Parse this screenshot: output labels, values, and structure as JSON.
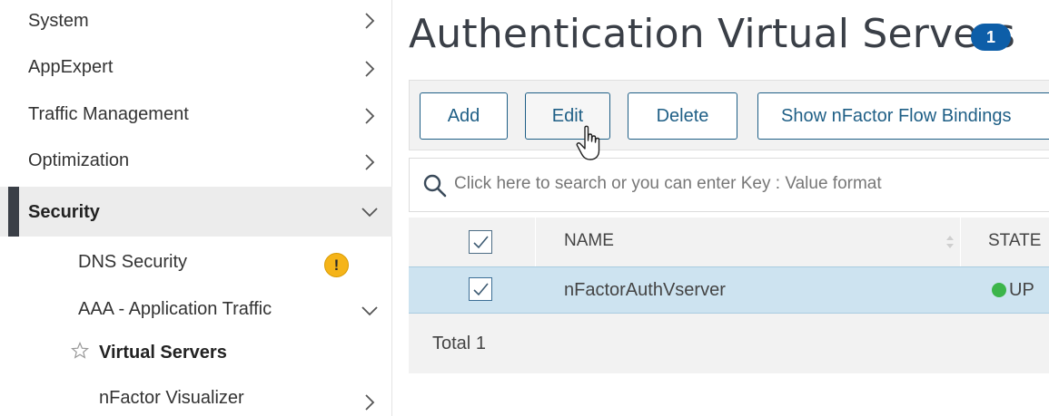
{
  "sidebar": {
    "items": [
      {
        "label": "System"
      },
      {
        "label": "AppExpert"
      },
      {
        "label": "Traffic Management"
      },
      {
        "label": "Optimization"
      },
      {
        "label": "Security"
      }
    ],
    "sub_items": [
      {
        "label": "DNS Security",
        "badge": "!"
      },
      {
        "label": "AAA - Application Traffic"
      },
      {
        "label": "Virtual Servers"
      },
      {
        "label": "nFactor Visualizer"
      }
    ]
  },
  "main": {
    "title": "Authentication Virtual Servers",
    "count": "1",
    "toolbar": {
      "add": "Add",
      "edit": "Edit",
      "delete": "Delete",
      "show_bindings": "Show nFactor Flow Bindings"
    },
    "search": {
      "placeholder": "Click here to search or you can enter Key : Value format"
    },
    "table": {
      "columns": [
        "NAME",
        "STATE"
      ],
      "rows": [
        {
          "name": "nFactorAuthVserver",
          "state": "UP",
          "checked": true
        }
      ],
      "total_label": "Total",
      "total_value": "1"
    }
  },
  "colors": {
    "accent": "#1f5f86",
    "badge": "#0d5ea8",
    "selected_row": "#cde3f0",
    "state_up": "#3bb54a",
    "warning": "#f5b419"
  }
}
